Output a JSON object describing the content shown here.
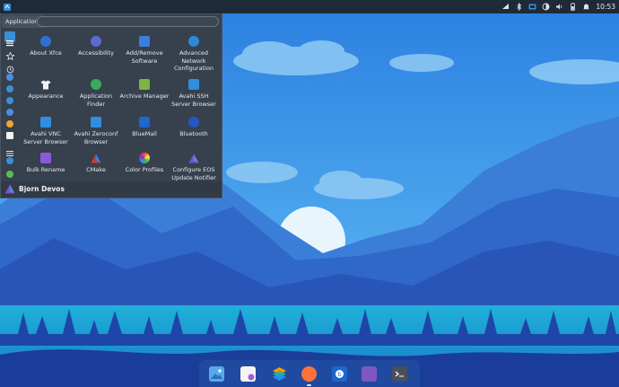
{
  "panel": {
    "clock": "10:53",
    "tray_icons": [
      "network-icon",
      "bluetooth-icon",
      "dropbox-icon",
      "brightness-icon",
      "volume-icon",
      "battery-icon",
      "notification-bell-icon"
    ],
    "menu_icon": "app-menu-icon"
  },
  "menu": {
    "tab_label": "Applications",
    "search_placeholder": "",
    "categories": [
      {
        "icon": "all-apps-icon",
        "active": true
      },
      {
        "icon": "favorites-star-icon",
        "active": false
      },
      {
        "icon": "recent-icon",
        "active": false
      },
      {
        "icon": "accessibility-icon",
        "active": false
      },
      {
        "icon": "development-icon",
        "active": false
      },
      {
        "icon": "graphics-icon",
        "active": false
      },
      {
        "icon": "internet-icon",
        "active": false
      },
      {
        "icon": "multimedia-icon",
        "active": false
      },
      {
        "icon": "office-icon",
        "active": false
      },
      {
        "icon": "settings-icon",
        "active": false
      },
      {
        "icon": "system-icon",
        "active": false
      },
      {
        "icon": "utilities-icon",
        "active": false
      }
    ],
    "apps": [
      {
        "label": "About Xfce",
        "icon": "xfce-mouse-icon",
        "color": "#2f6fd1"
      },
      {
        "label": "Accessibility",
        "icon": "accessibility-icon",
        "color": "#5a6ccf"
      },
      {
        "label": "Add/Remove Software",
        "icon": "package-icon",
        "color": "#3a7fe0"
      },
      {
        "label": "Advanced Network Configuration",
        "icon": "network-config-icon",
        "color": "#2d8ad6"
      },
      {
        "label": "Appearance",
        "icon": "tshirt-icon",
        "color": "#f2f2f2"
      },
      {
        "label": "Application Finder",
        "icon": "finder-icon",
        "color": "#3aaa5c"
      },
      {
        "label": "Archive Manager",
        "icon": "archive-icon",
        "color": "#7cb342"
      },
      {
        "label": "Avahi SSH Server Browser",
        "icon": "monitor-icon",
        "color": "#2f8ee0"
      },
      {
        "label": "Avahi VNC Server Browser",
        "icon": "monitor-icon",
        "color": "#2f8ee0"
      },
      {
        "label": "Avahi Zeroconf Browser",
        "icon": "monitor-icon",
        "color": "#2f8ee0"
      },
      {
        "label": "BlueMail",
        "icon": "bluemail-icon",
        "color": "#1e66d0"
      },
      {
        "label": "Bluetooth",
        "icon": "bluetooth-icon",
        "color": "#2457c5"
      },
      {
        "label": "Bulk Rename",
        "icon": "folder-icon",
        "color": "#8b5ad8"
      },
      {
        "label": "CMake",
        "icon": "cmake-triangle-icon",
        "color": "#d8392b"
      },
      {
        "label": "Color Profiles",
        "icon": "color-wheel-icon",
        "color": "#e85d9b"
      },
      {
        "label": "Configure EOS Update Notifier",
        "icon": "eos-logo-icon",
        "color": "#7f4fc9"
      }
    ],
    "user_name": "Bjorn Devos",
    "user_icon": "endeavouros-logo-icon"
  },
  "dock": {
    "items": [
      {
        "icon": "image-viewer-icon",
        "color": "#5aa8ea"
      },
      {
        "icon": "document-viewer-icon",
        "color": "#f4f4f4"
      },
      {
        "icon": "layers-app-icon",
        "color": "#36b37e"
      },
      {
        "icon": "firefox-icon",
        "color": "#ff7139"
      },
      {
        "icon": "bluemail-icon",
        "color": "#1e66d0"
      },
      {
        "icon": "file-manager-icon",
        "color": "#7e57c2"
      },
      {
        "icon": "terminal-icon",
        "color": "#4a4f58"
      }
    ]
  }
}
